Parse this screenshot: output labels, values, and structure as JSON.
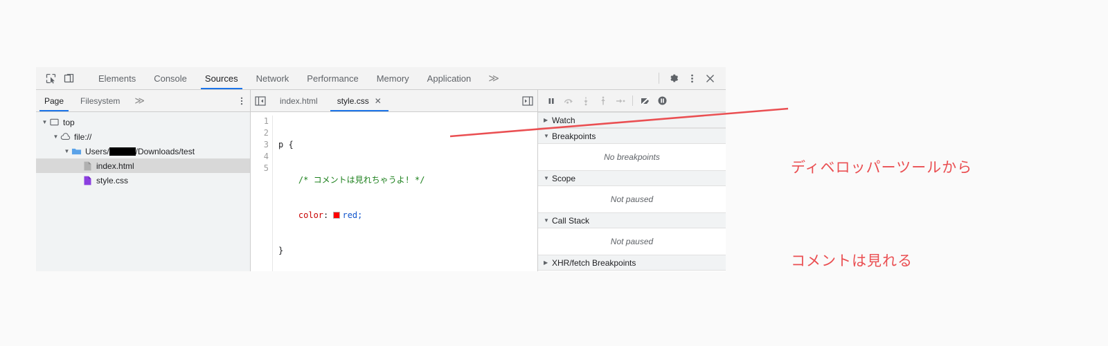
{
  "devtools": {
    "main_tabs": [
      {
        "label": "Elements",
        "active": false
      },
      {
        "label": "Console",
        "active": false
      },
      {
        "label": "Sources",
        "active": true
      },
      {
        "label": "Network",
        "active": false
      },
      {
        "label": "Performance",
        "active": false
      },
      {
        "label": "Memory",
        "active": false
      },
      {
        "label": "Application",
        "active": false
      }
    ],
    "more_tabs_label": "≫",
    "icons": {
      "inspect": "inspect-element-icon",
      "device": "device-toolbar-icon",
      "settings": "gear-icon",
      "kebab": "more-options-icon",
      "close": "close-icon"
    },
    "navigator": {
      "tabs": [
        {
          "label": "Page",
          "active": true
        },
        {
          "label": "Filesystem",
          "active": false
        }
      ],
      "more_label": "≫",
      "tree": [
        {
          "label": "top",
          "icon": "frame-icon",
          "depth": 0,
          "twisty": "▼",
          "selected": false
        },
        {
          "label": "file://",
          "icon": "cloud-icon",
          "depth": 1,
          "twisty": "▼",
          "selected": false
        },
        {
          "label": "Users/████/Downloads/test",
          "icon": "folder-icon",
          "depth": 2,
          "twisty": "▼",
          "selected": false
        },
        {
          "label": "index.html",
          "icon": "document-icon",
          "depth": 3,
          "twisty": "",
          "selected": true
        },
        {
          "label": "style.css",
          "icon": "stylesheet-icon",
          "depth": 3,
          "twisty": "",
          "selected": false
        }
      ],
      "redacted_path_prefix": "Users/",
      "redacted_path_suffix": "/Downloads/test"
    },
    "editor": {
      "tabs": [
        {
          "label": "index.html",
          "active": false,
          "closable": false
        },
        {
          "label": "style.css",
          "active": true,
          "closable": true
        }
      ],
      "close_glyph": "✕",
      "navigator_toggle_icon": "show-navigator-icon",
      "debugger_toggle_icon": "show-debugger-icon",
      "line_numbers": [
        "1",
        "2",
        "3",
        "4",
        "5"
      ],
      "code": {
        "line1": "p {",
        "line2_comment": "/* コメントは見れちゃうよ! */",
        "line3_prop": "color",
        "line3_colon": ": ",
        "line3_value": "red",
        "line3_semicolon": ";",
        "line4": "}",
        "swatch_color": "#ff0000",
        "comment_color": "#1a7f1a",
        "property_color": "#c80000",
        "value_color": "#1155cc"
      }
    },
    "debugger": {
      "buttons": [
        {
          "name": "pause-script-execution",
          "glyph": "pause"
        },
        {
          "name": "step-over-next-function-call",
          "glyph": "step-over"
        },
        {
          "name": "step-into-next-function-call",
          "glyph": "step-into"
        },
        {
          "name": "step-out-of-current-function",
          "glyph": "step-out"
        },
        {
          "name": "step",
          "glyph": "step"
        },
        {
          "name": "deactivate-breakpoints",
          "glyph": "deactivate"
        },
        {
          "name": "pause-on-exceptions",
          "glyph": "exceptions"
        }
      ],
      "panes": [
        {
          "title": "Watch",
          "expanded": false,
          "empty_text": ""
        },
        {
          "title": "Breakpoints",
          "expanded": true,
          "empty_text": "No breakpoints"
        },
        {
          "title": "Scope",
          "expanded": true,
          "empty_text": "Not paused"
        },
        {
          "title": "Call Stack",
          "expanded": true,
          "empty_text": "Not paused"
        },
        {
          "title": "XHR/fetch Breakpoints",
          "expanded": false,
          "empty_text": ""
        }
      ],
      "expanded_glyph": "▼",
      "collapsed_glyph": "▶"
    }
  },
  "annotation": {
    "line1": "ディベロッパーツールから",
    "line2": "コメントは見れる",
    "color": "#ea4f52"
  }
}
